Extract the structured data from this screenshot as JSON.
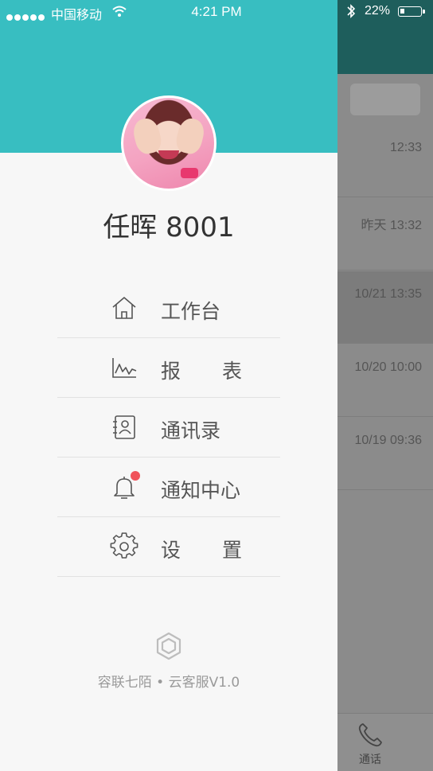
{
  "status_bar": {
    "carrier": "中国移动",
    "time": "4:21 PM",
    "battery": "22%",
    "battery_level": 0.22
  },
  "drawer": {
    "user_name": "任晖 8001",
    "menu": [
      {
        "label": "工作台",
        "icon": "home-icon"
      },
      {
        "label": "报 表",
        "icon": "chart-icon"
      },
      {
        "label": "通讯录",
        "icon": "contacts-icon"
      },
      {
        "label": "通知中心",
        "icon": "bell-icon",
        "has_badge": true
      },
      {
        "label": "设 置",
        "icon": "gear-icon"
      }
    ],
    "footer_text": "容联七陌 • 云客服V1.0",
    "accent_color": "#38bec1",
    "badge_color": "#f0525a"
  },
  "background_app": {
    "header_color": "#1e5e5c",
    "conversation_times": [
      "12:33",
      "昨天 13:32",
      "10/21 13:35",
      "10/20 10:00",
      "10/19 09:36"
    ],
    "tab_label": "通话"
  }
}
